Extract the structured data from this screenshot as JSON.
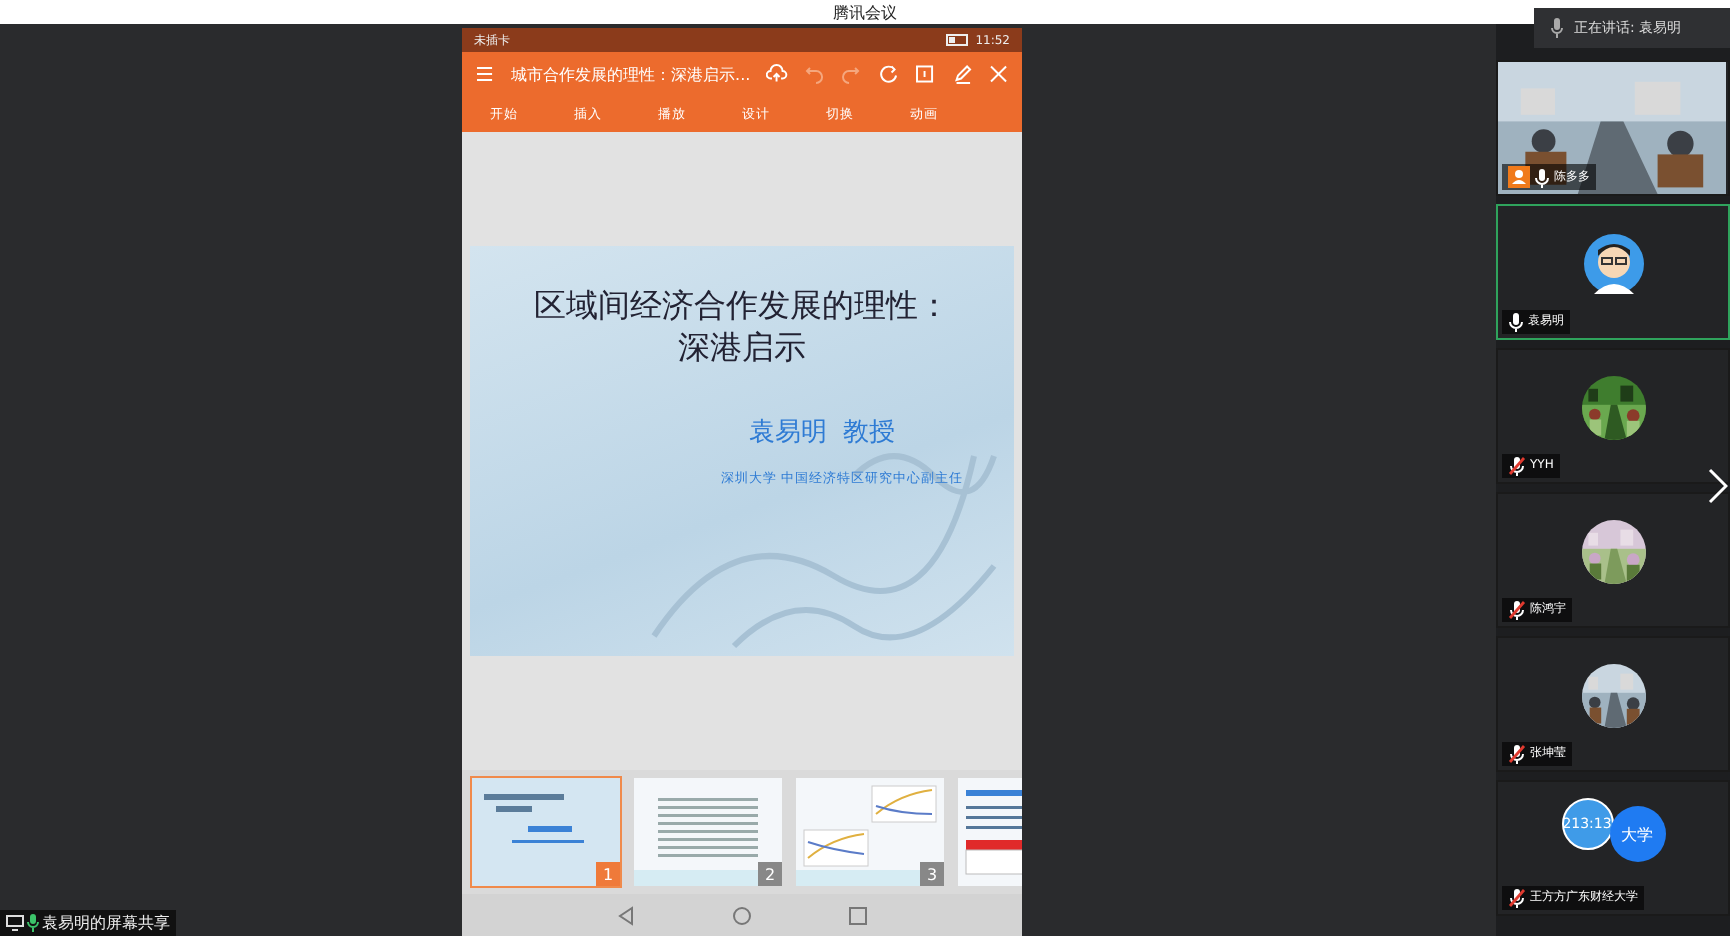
{
  "window": {
    "title": "腾讯会议"
  },
  "speaking": {
    "label": "正在讲话: 袁易明"
  },
  "share": {
    "status_bar": {
      "carrier": "未插卡",
      "time": "11:52"
    },
    "doc_title": "城市合作发展的理性：深港启示...",
    "ribbon_tabs": [
      "开始",
      "插入",
      "播放",
      "设计",
      "切换",
      "动画"
    ],
    "slide": {
      "title": "区域间经济合作发展的理性：",
      "subtitle": "深港启示",
      "author": "袁易明  教授",
      "affiliation": "深圳大学 中国经济特区研究中心副主任"
    },
    "thumbnails": [
      {
        "number": "1",
        "kind": "title",
        "selected": true
      },
      {
        "number": "2",
        "kind": "text",
        "selected": false
      },
      {
        "number": "3",
        "kind": "chart",
        "selected": false
      },
      {
        "kind": "table",
        "selected": false
      }
    ]
  },
  "share_label": "袁易明的屏幕共享",
  "participants": [
    {
      "name": "陈多多",
      "kind": "video",
      "muted": false,
      "host": true,
      "active": false
    },
    {
      "name": "袁易明",
      "kind": "cartoon",
      "muted": false,
      "host": false,
      "active": true
    },
    {
      "name": "YYH",
      "muted": true,
      "host": false,
      "active": false
    },
    {
      "name": "陈鸿宇",
      "muted": true,
      "host": false,
      "active": false
    },
    {
      "name": "张坤莹",
      "muted": true,
      "host": false,
      "active": false
    },
    {
      "name": "王方方广东财经大学",
      "kind": "badges",
      "muted": true,
      "host": false,
      "active": false,
      "avatar_texts": [
        "213:13",
        "大学"
      ]
    }
  ]
}
